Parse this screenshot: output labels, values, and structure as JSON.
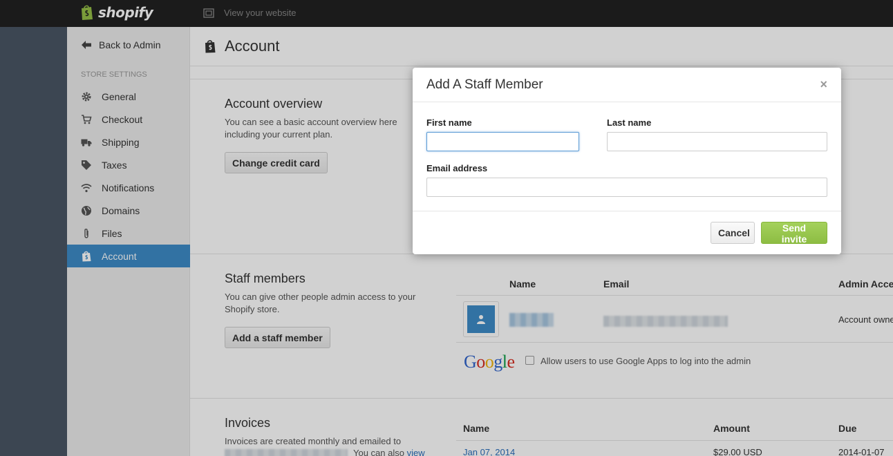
{
  "topbar": {
    "brand": "shopify",
    "view_site": "View your website"
  },
  "sidebar": {
    "back_label": "Back to Admin",
    "section_label": "STORE SETTINGS",
    "items": [
      {
        "label": "General",
        "icon": "gear-icon"
      },
      {
        "label": "Checkout",
        "icon": "cart-icon"
      },
      {
        "label": "Shipping",
        "icon": "truck-icon"
      },
      {
        "label": "Taxes",
        "icon": "tag-icon"
      },
      {
        "label": "Notifications",
        "icon": "wifi-icon"
      },
      {
        "label": "Domains",
        "icon": "globe-icon"
      },
      {
        "label": "Files",
        "icon": "paperclip-icon"
      },
      {
        "label": "Account",
        "icon": "shopify-bag-icon",
        "active": true
      }
    ]
  },
  "page": {
    "title": "Account"
  },
  "overview": {
    "title": "Account overview",
    "desc": "You can see a basic account overview here including your current plan.",
    "button": "Change credit card"
  },
  "staff": {
    "title": "Staff members",
    "desc": "You can give other people admin access to your Shopify store.",
    "button": "Add a staff member",
    "columns": [
      "Name",
      "Email",
      "Admin Access"
    ],
    "rows": [
      {
        "access": "Account owner"
      }
    ],
    "google_label": "Allow users to use Google Apps to log into the admin"
  },
  "invoices": {
    "title": "Invoices",
    "desc_line1": "Invoices are created monthly and emailed to",
    "desc_line2_suffix": "You can also",
    "desc_link": "view",
    "columns": [
      "Name",
      "Amount",
      "Due"
    ],
    "rows": [
      {
        "name": "Jan 07, 2014",
        "amount": "$29.00 USD",
        "due": "2014-01-07"
      }
    ]
  },
  "modal": {
    "title": "Add A Staff Member",
    "close": "×",
    "first_name_label": "First name",
    "last_name_label": "Last name",
    "email_label": "Email address",
    "first_name_value": "",
    "last_name_value": "",
    "email_value": "",
    "cancel": "Cancel",
    "send": "Send invite"
  },
  "colors": {
    "accent": "#3d8bc7",
    "send_button": "#96c44d",
    "topbar": "#222222"
  }
}
